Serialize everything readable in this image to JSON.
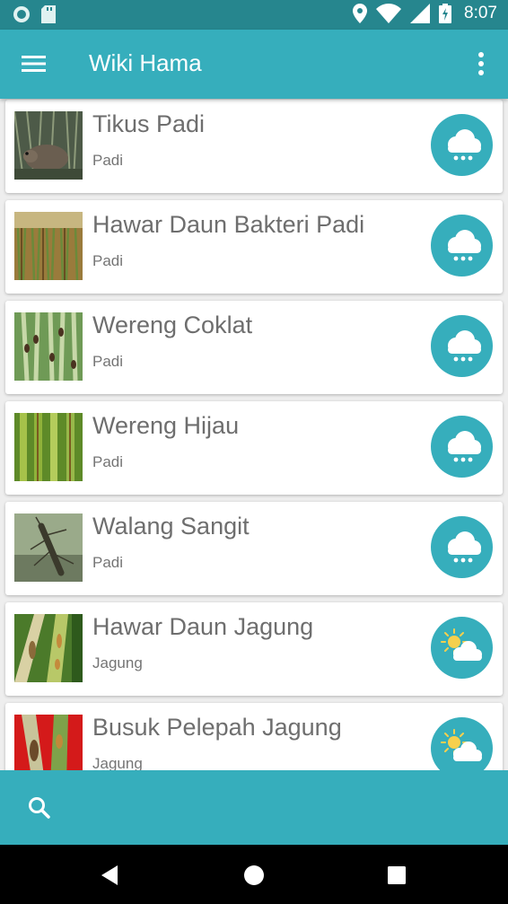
{
  "status_bar": {
    "time": "8:07",
    "icons": [
      "record-icon",
      "sd-card-icon",
      "location-icon",
      "wifi-icon",
      "signal-icon",
      "battery-charging-icon"
    ]
  },
  "app_bar": {
    "title": "Wiki Hama",
    "menu_icon": "menu-icon",
    "overflow_icon": "more-vert-icon"
  },
  "items": [
    {
      "title": "Tikus Padi",
      "subtitle": "Padi",
      "image": "rat-thumbnail",
      "weather": "rain"
    },
    {
      "title": "Hawar Daun Bakteri Padi",
      "subtitle": "Padi",
      "image": "rice-field-thumbnail",
      "weather": "rain"
    },
    {
      "title": "Wereng Coklat",
      "subtitle": "Padi",
      "image": "brown-planthopper-thumbnail",
      "weather": "rain"
    },
    {
      "title": "Wereng Hijau",
      "subtitle": "Padi",
      "image": "green-stalks-thumbnail",
      "weather": "rain"
    },
    {
      "title": "Walang Sangit",
      "subtitle": "Padi",
      "image": "rice-bug-thumbnail",
      "weather": "rain"
    },
    {
      "title": "Hawar Daun Jagung",
      "subtitle": "Jagung",
      "image": "corn-leaf-blight-thumbnail",
      "weather": "sun-cloud"
    },
    {
      "title": "Busuk Pelepah Jagung",
      "subtitle": "Jagung",
      "image": "corn-sheath-rot-thumbnail",
      "weather": "sun-cloud"
    }
  ],
  "bottom_bar": {
    "search_icon": "search-icon"
  },
  "nav_bar": {
    "buttons": [
      "back-icon",
      "home-icon",
      "recents-icon"
    ]
  },
  "colors": {
    "status_bar": "#26868e",
    "primary": "#36aebc",
    "card": "#ffffff",
    "title_text": "#6e6e6e",
    "subtitle_text": "#757575",
    "background": "#eeeeee"
  }
}
